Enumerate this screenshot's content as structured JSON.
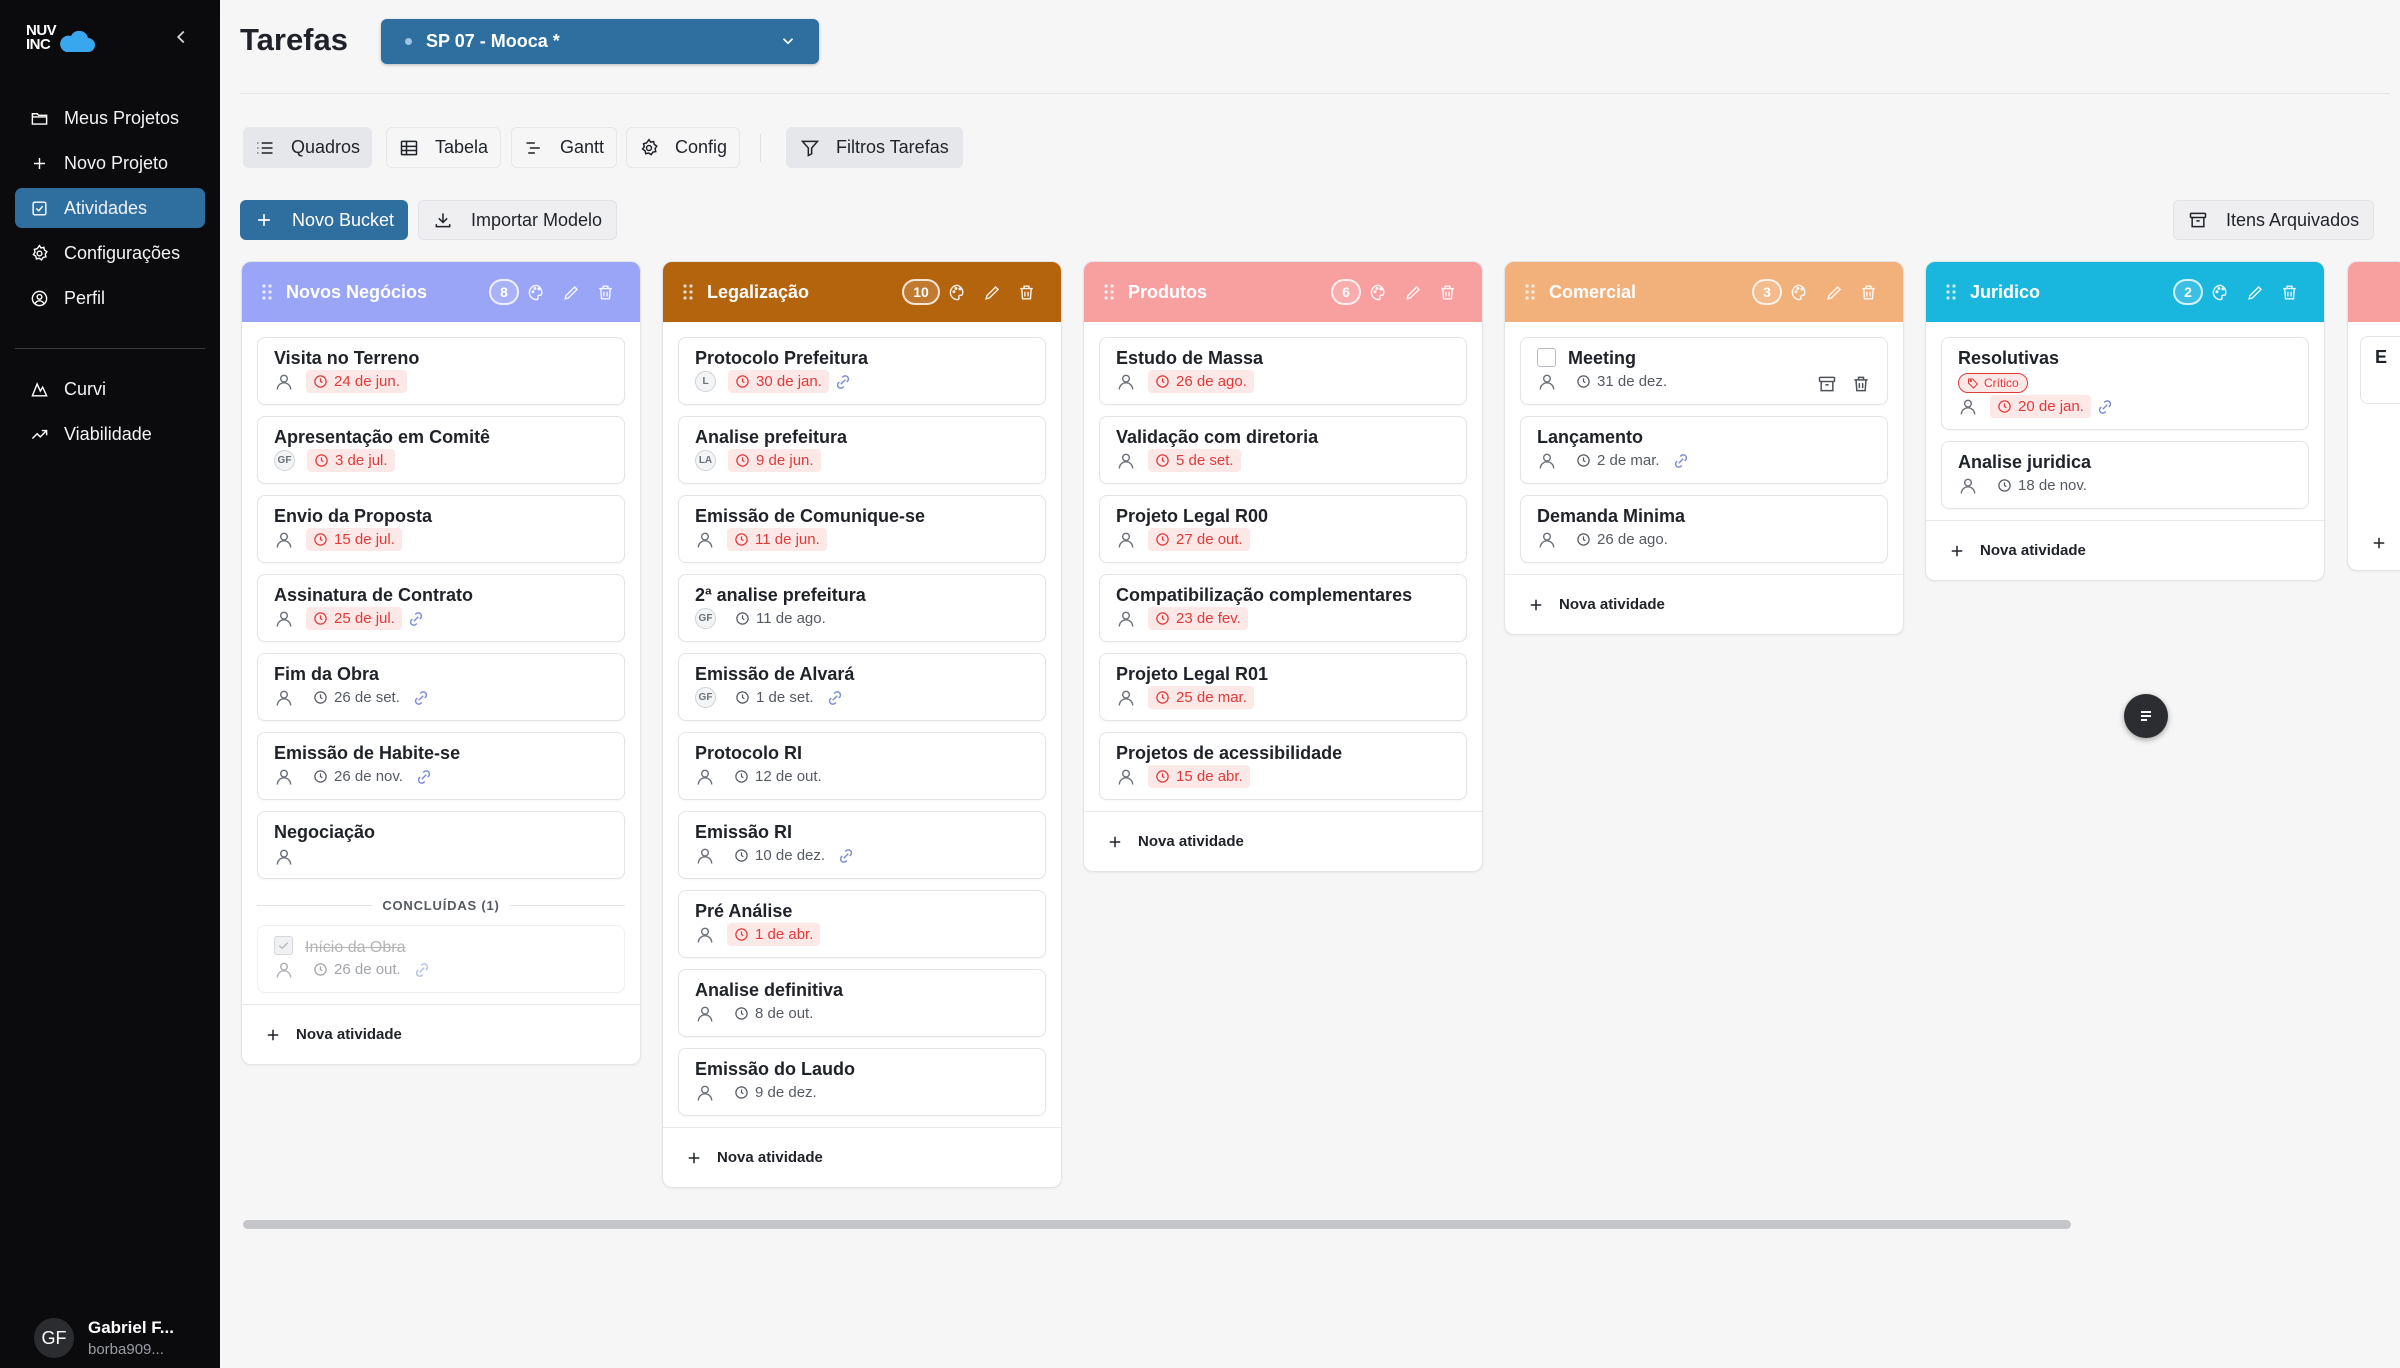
{
  "sidebar": {
    "logo_line1": "NUV",
    "logo_line2": "INC",
    "nav": [
      {
        "label": "Meus Projetos",
        "icon": "folder-icon"
      },
      {
        "label": "Novo Projeto",
        "icon": "plus-icon"
      },
      {
        "label": "Atividades",
        "icon": "checkbox-icon",
        "active": true
      },
      {
        "label": "Configurações",
        "icon": "gear-icon"
      },
      {
        "label": "Perfil",
        "icon": "user-circle-icon"
      }
    ],
    "nav2": [
      {
        "label": "Curvi",
        "icon": "curve-icon"
      },
      {
        "label": "Viabilidade",
        "icon": "trend-up-icon"
      }
    ],
    "user": {
      "initials": "GF",
      "name": "Gabriel F...",
      "email": "borba909..."
    }
  },
  "header": {
    "title": "Tarefas",
    "project": "SP 07 - Mooca *"
  },
  "toolbar": {
    "views": [
      "Quadros",
      "Tabela",
      "Gantt",
      "Config"
    ],
    "filter": "Filtros Tarefas",
    "new_bucket": "Novo Bucket",
    "import": "Importar Modelo",
    "archived": "Itens Arquivados"
  },
  "colors": {
    "primary": "#2f6fa0",
    "novos": "#9aa5f7",
    "legal": "#b5640e",
    "produtos": "#f8a0a0",
    "comercial": "#f2b07b",
    "juridico": "#19b6de",
    "late": "#e03a3a"
  },
  "board": {
    "new_activity": "Nova atividade",
    "columns": [
      {
        "name": "Novos Negócios",
        "count": "8",
        "color": "#9aa5f7",
        "cards": [
          {
            "title": "Visita no Terreno",
            "assignee": "",
            "date": "24 de jun.",
            "late": true,
            "link": false
          },
          {
            "title": "Apresentação em Comitê",
            "assignee": "GF",
            "date": "3 de jul.",
            "late": true,
            "link": false
          },
          {
            "title": "Envio da Proposta",
            "assignee": "",
            "date": "15 de jul.",
            "late": true,
            "link": false
          },
          {
            "title": "Assinatura de Contrato",
            "assignee": "",
            "date": "25 de jul.",
            "late": true,
            "link": true
          },
          {
            "title": "Fim da Obra",
            "assignee": "",
            "date": "26 de set.",
            "late": false,
            "link": true
          },
          {
            "title": "Emissão de Habite-se",
            "assignee": "",
            "date": "26 de nov.",
            "late": false,
            "link": true
          },
          {
            "title": "Negociação",
            "assignee": "",
            "date": "",
            "late": false,
            "link": false
          }
        ],
        "completed_label": "CONCLUÍDAS (1)",
        "completed": [
          {
            "title": "Início da Obra",
            "assignee": "",
            "date": "26 de out.",
            "late": false,
            "link": true
          }
        ]
      },
      {
        "name": "Legalização",
        "count": "10",
        "color": "#b5640e",
        "cards": [
          {
            "title": "Protocolo Prefeitura",
            "assignee": "L",
            "date": "30 de jan.",
            "late": true,
            "link": true
          },
          {
            "title": "Analise prefeitura",
            "assignee": "LA",
            "date": "9 de jun.",
            "late": true,
            "link": false
          },
          {
            "title": "Emissão de Comunique-se",
            "assignee": "",
            "date": "11 de jun.",
            "late": true,
            "link": false
          },
          {
            "title": "2ª analise prefeitura",
            "assignee": "GF",
            "date": "11 de ago.",
            "late": false,
            "link": false
          },
          {
            "title": "Emissão de Alvará",
            "assignee": "GF",
            "date": "1 de set.",
            "late": false,
            "link": true
          },
          {
            "title": "Protocolo RI",
            "assignee": "",
            "date": "12 de out.",
            "late": false,
            "link": false
          },
          {
            "title": "Emissão RI",
            "assignee": "",
            "date": "10 de dez.",
            "late": false,
            "link": true
          },
          {
            "title": "Pré Análise",
            "assignee": "",
            "date": "1 de abr.",
            "late": true,
            "link": false
          },
          {
            "title": "Analise definitiva",
            "assignee": "",
            "date": "8 de out.",
            "late": false,
            "link": false
          },
          {
            "title": "Emissão do Laudo",
            "assignee": "",
            "date": "9 de dez.",
            "late": false,
            "link": false
          }
        ]
      },
      {
        "name": "Produtos",
        "count": "6",
        "color": "#f8a0a0",
        "cards": [
          {
            "title": "Estudo de Massa",
            "assignee": "",
            "date": "26 de ago.",
            "late": true,
            "link": false
          },
          {
            "title": "Validação com diretoria",
            "assignee": "",
            "date": "5 de set.",
            "late": true,
            "link": false
          },
          {
            "title": "Projeto Legal R00",
            "assignee": "",
            "date": "27 de out.",
            "late": true,
            "link": false
          },
          {
            "title": "Compatibilização complementares",
            "assignee": "",
            "date": "23 de fev.",
            "late": true,
            "link": false
          },
          {
            "title": "Projeto Legal R01",
            "assignee": "",
            "date": "25 de mar.",
            "late": true,
            "link": false
          },
          {
            "title": "Projetos de acessibilidade",
            "assignee": "",
            "date": "15 de abr.",
            "late": true,
            "link": false
          }
        ]
      },
      {
        "name": "Comercial",
        "count": "3",
        "color": "#f2b07b",
        "cards": [
          {
            "title": "Meeting",
            "assignee": "",
            "date": "31 de dez.",
            "late": false,
            "link": false,
            "checkbox": true,
            "actions": true
          },
          {
            "title": "Lançamento",
            "assignee": "",
            "date": "2 de mar.",
            "late": false,
            "link": true
          },
          {
            "title": "Demanda Minima",
            "assignee": "",
            "date": "26 de ago.",
            "late": false,
            "link": false
          }
        ]
      },
      {
        "name": "Juridico",
        "count": "2",
        "color": "#19b6de",
        "cards": [
          {
            "title": "Resolutivas",
            "assignee": "",
            "date": "20 de jan.",
            "late": true,
            "link": true,
            "badge": "Crítico"
          },
          {
            "title": "Analise juridica",
            "assignee": "",
            "date": "18 de nov.",
            "late": false,
            "link": false
          }
        ]
      }
    ],
    "partial_column": {
      "title_initial": "E",
      "color": "#f8a0a0"
    }
  }
}
